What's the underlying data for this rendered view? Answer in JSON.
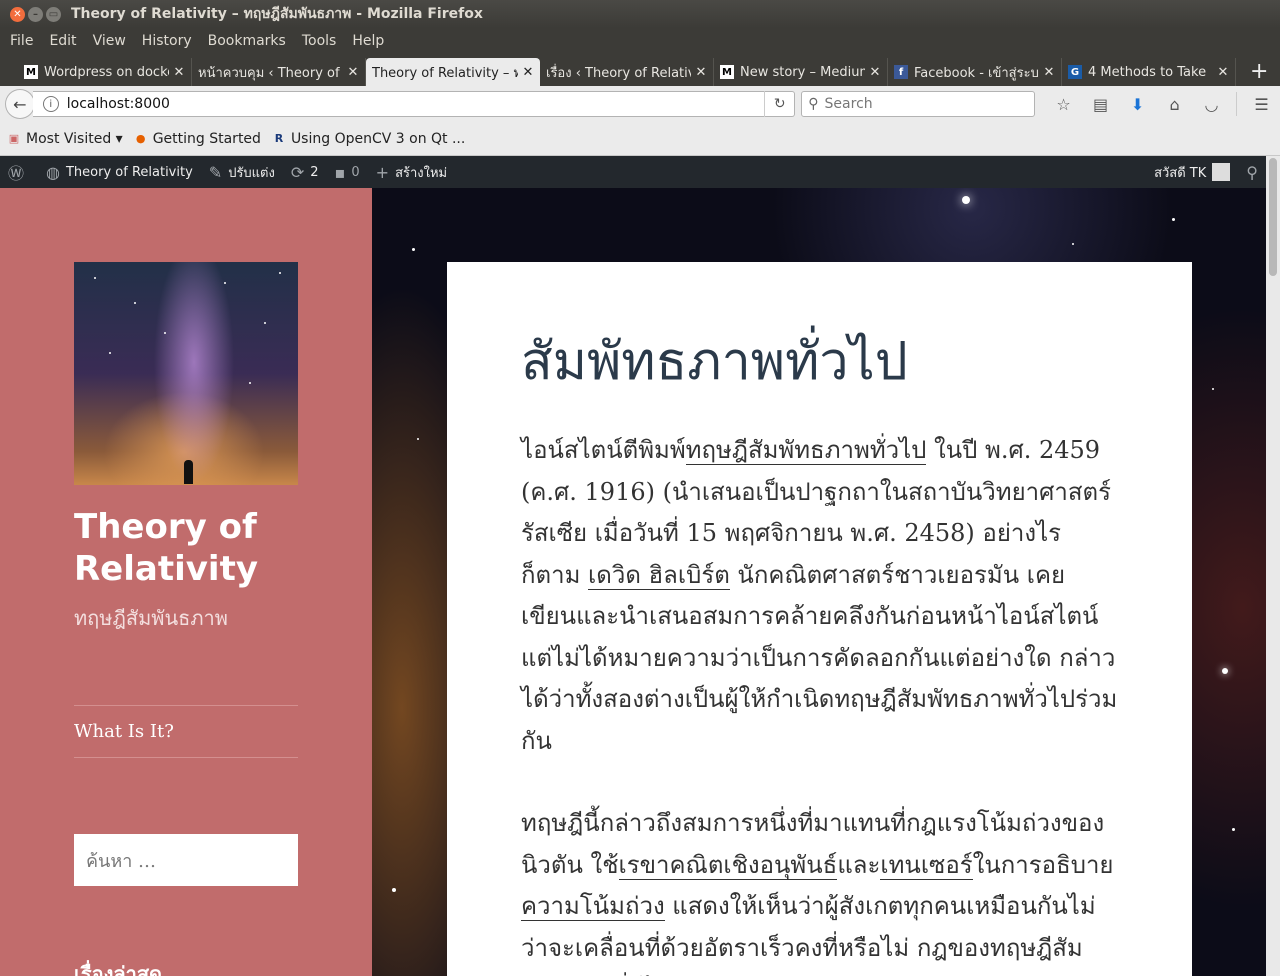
{
  "window": {
    "title": "Theory of Relativity – ทฤษฎีสัมพันธภาพ - Mozilla Firefox"
  },
  "menu": [
    {
      "label": "File"
    },
    {
      "label": "Edit"
    },
    {
      "label": "View"
    },
    {
      "label": "History"
    },
    {
      "label": "Bookmarks"
    },
    {
      "label": "Tools"
    },
    {
      "label": "Help"
    }
  ],
  "tabs": [
    {
      "title": "Wordpress on docker",
      "icon": "M",
      "active": false
    },
    {
      "title": "หน้าควบคุม ‹ Theory of",
      "icon": "W",
      "active": false
    },
    {
      "title": "Theory of Relativity – ทฤษ",
      "icon": "",
      "active": true
    },
    {
      "title": "เรื่อง ‹ Theory of Relativity",
      "icon": "",
      "active": false
    },
    {
      "title": "New story – Medium",
      "icon": "M",
      "active": false
    },
    {
      "title": "Facebook - เข้าสู่ระบบ",
      "icon": "f",
      "active": false
    },
    {
      "title": "4 Methods to Take",
      "icon": "G",
      "active": false
    }
  ],
  "nav": {
    "url": "localhost:8000",
    "search_placeholder": "Search"
  },
  "bookmarks": [
    {
      "label": "Most Visited ▾"
    },
    {
      "label": "Getting Started"
    },
    {
      "label": "Using OpenCV 3 on Qt ..."
    }
  ],
  "adminbar": {
    "site": "Theory of Relativity",
    "customize": "ปรับแต่ง",
    "updates": "2",
    "comments": "0",
    "new": "สร้างใหม่",
    "greeting": "สวัสดี TK"
  },
  "sidebar": {
    "title": "Theory of Relativity",
    "description": "ทฤษฎีสัมพันธภาพ",
    "nav_item": "What Is It?",
    "search_placeholder": "ค้นหา …",
    "recent_heading": "เรื่องล่าสุด"
  },
  "article": {
    "title": "สัมพัทธภาพทั่วไป",
    "p1": {
      "a": "ไอน์สไตน์ตีพิมพ์",
      "link1": "ทฤษฎีสัมพัทธภาพทั่วไป",
      "b": " ในปี พ.ศ. 2459 (ค.ศ. 1916) (นำเสนอเป็นปาฐกถาในสถาบันวิทยาศาสตร์รัสเซีย เมื่อวันที่ 15 พฤศจิกายน พ.ศ. 2458) อย่างไรก็ตาม ",
      "link2": "เดวิด ฮิลเบิร์ต",
      "c": " นักคณิตศาสตร์ชาวเยอรมัน เคยเขียนและนำเสนอสมการคล้ายคลึงกันก่อนหน้าไอน์สไตน์ แต่ไม่ได้หมายความว่าเป็นการคัดลอกกันแต่อย่างใด กล่าวได้ว่าทั้งสองต่างเป็นผู้ให้กำเนิดทฤษฎีสัมพัทธภาพทั่วไปร่วมกัน"
    },
    "p2": {
      "a": "ทฤษฎีนี้กล่าวถึงสมการหนึ่งที่มาแทนที่กฎแรงโน้มถ่วงของนิวตัน ใช้",
      "link1": "เรขาคณิตเชิงอนุพันธ์",
      "b": "และ",
      "link2": "เทนเซอร์",
      "c": "ในการอธิบาย",
      "link3": "ความโน้มถ่วง",
      "d": " แสดงให้เห็นว่าผู้สังเกตทุกคนเหมือนกันไม่ว่าจะเคลื่อนที่ด้วยอัตราเร็วคงที่หรือไม่ กฎของทฤษฎีสัมพัทธภาพทั่วไปเหมือนกันสำหรับผู้สังเกตทุกคน"
    }
  },
  "colors": {
    "sidebar": "#c16c6c",
    "adminbar": "#23282d",
    "title_text": "#2b3a4a"
  }
}
